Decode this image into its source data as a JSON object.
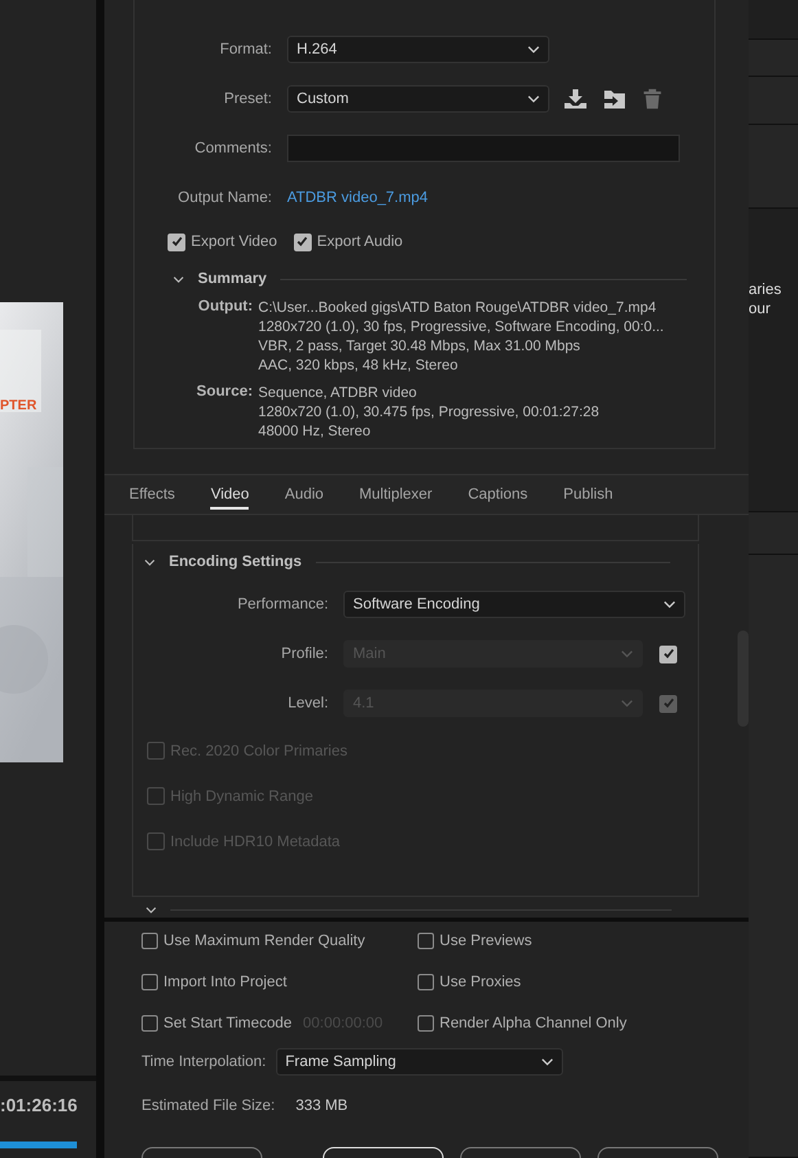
{
  "preview": {
    "overlay_text": "PTER",
    "timecode": ":01:26:16"
  },
  "side_panel": {
    "texts": [
      "aries",
      "our"
    ]
  },
  "export_settings": {
    "format": {
      "label": "Format:",
      "value": "H.264"
    },
    "preset": {
      "label": "Preset:",
      "value": "Custom"
    },
    "comments": {
      "label": "Comments:"
    },
    "output_name": {
      "label": "Output Name:",
      "value": "ATDBR video_7.mp4"
    },
    "exports": [
      {
        "label": "Export Video",
        "checked": true
      },
      {
        "label": "Export Audio",
        "checked": true
      }
    ],
    "summary": {
      "title": "Summary",
      "expanded": true,
      "rows": [
        {
          "label": "Output:",
          "lines": [
            "C:\\User...Booked gigs\\ATD Baton Rouge\\ATDBR video_7.mp4",
            "1280x720 (1.0), 30 fps, Progressive, Software Encoding, 00:0...",
            "VBR, 2 pass, Target 30.48 Mbps, Max 31.00 Mbps",
            "AAC, 320 kbps, 48 kHz, Stereo"
          ]
        },
        {
          "label": "Source:",
          "lines": [
            "Sequence, ATDBR video",
            "1280x720 (1.0), 30.475 fps, Progressive, 00:01:27:28",
            "48000 Hz, Stereo"
          ]
        }
      ]
    }
  },
  "tabs": [
    {
      "label": "Effects",
      "selected": false
    },
    {
      "label": "Video",
      "selected": true
    },
    {
      "label": "Audio",
      "selected": false
    },
    {
      "label": "Multiplexer",
      "selected": false
    },
    {
      "label": "Captions",
      "selected": false
    },
    {
      "label": "Publish",
      "selected": false
    }
  ],
  "encoding": {
    "title": "Encoding Settings",
    "expanded": true,
    "fields": [
      {
        "label": "Performance:",
        "value": "Software Encoding",
        "disabled": false
      },
      {
        "label": "Profile:",
        "value": "Main",
        "disabled": true,
        "checked": true,
        "checkbox_disabled": false
      },
      {
        "label": "Level:",
        "value": "4.1",
        "disabled": true,
        "checked": true,
        "checkbox_disabled": true
      }
    ],
    "options": [
      {
        "label": "Rec. 2020 Color Primaries",
        "checked": false,
        "disabled": true
      },
      {
        "label": "High Dynamic Range",
        "checked": false,
        "disabled": true
      },
      {
        "label": "Include HDR10 Metadata",
        "checked": false,
        "disabled": true
      }
    ]
  },
  "render_options": [
    {
      "label": "Use Maximum Render Quality",
      "checked": false
    },
    {
      "label": "Use Previews",
      "checked": false
    },
    {
      "label": "Import Into Project",
      "checked": false
    },
    {
      "label": "Use Proxies",
      "checked": false
    },
    {
      "label": "Set Start Timecode",
      "checked": false,
      "placeholder": "00:00:00:00"
    },
    {
      "label": "Render Alpha Channel Only",
      "checked": false
    }
  ],
  "time_interpolation": {
    "label": "Time Interpolation:",
    "value": "Frame Sampling"
  },
  "file_size": {
    "label": "Estimated File Size:",
    "value": "333 MB"
  }
}
